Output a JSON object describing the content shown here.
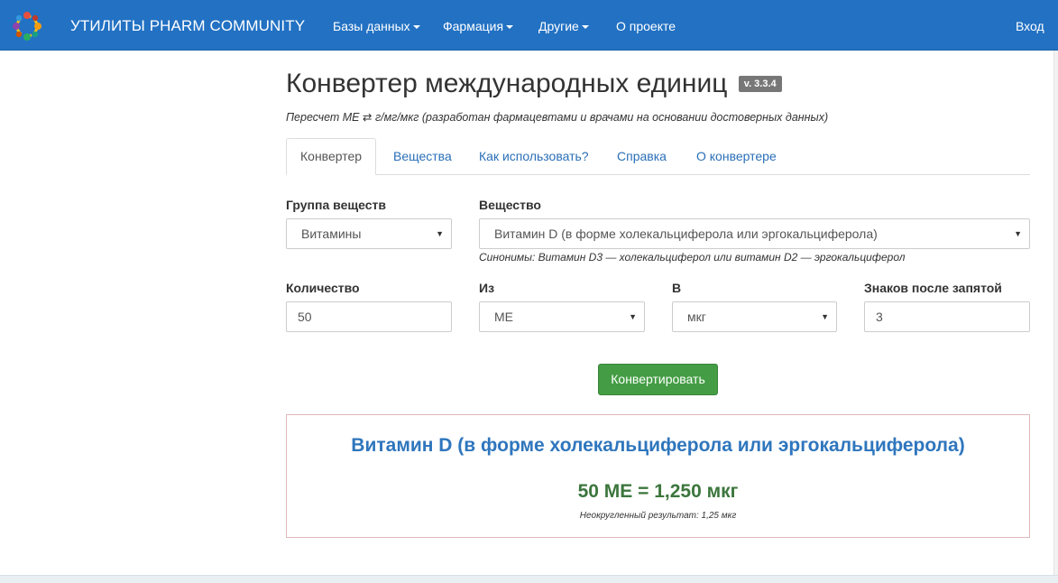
{
  "navbar": {
    "brand": "УТИЛИТЫ PHARM COMMUNITY",
    "items": [
      {
        "label": "Базы данных",
        "dropdown": true
      },
      {
        "label": "Фармация",
        "dropdown": true
      },
      {
        "label": "Другие",
        "dropdown": true
      },
      {
        "label": "О проекте",
        "dropdown": false
      }
    ],
    "login": "Вход",
    "logo_icon": "people-circle-logo-icon",
    "color": "#2271c3"
  },
  "header": {
    "title": "Конвертер международных единиц",
    "version": "v. 3.3.4",
    "subtitle": "Пересчет МЕ ⇄ г/мг/мкг (разработан фармацевтами и врачами на основании достоверных данных)"
  },
  "tabs": [
    {
      "label": "Конвертер",
      "active": true
    },
    {
      "label": "Вещества",
      "active": false
    },
    {
      "label": "Как использовать?",
      "active": false
    },
    {
      "label": "Справка",
      "active": false
    },
    {
      "label": "О конвертере",
      "active": false
    }
  ],
  "form": {
    "group_label": "Группа веществ",
    "group_value": "Витамины",
    "substance_label": "Вещество",
    "substance_value": "Витамин D (в форме холекальциферола или эргокальциферола)",
    "synonyms": "Синонимы: Витамин D3 — холекальциферол или витамин D2 — эргокальциферол",
    "quantity_label": "Количество",
    "quantity_value": "50",
    "from_label": "Из",
    "from_value": "МЕ",
    "to_label": "В",
    "to_value": "мкг",
    "decimals_label": "Знаков после запятой",
    "decimals_value": "3",
    "convert_button": "Конвертировать"
  },
  "result": {
    "title": "Витамин D (в форме холекальциферола или эргокальциферола)",
    "value": "50 МЕ = 1,250 мкг",
    "raw": "Неокругленный результат: 1,25 мкг"
  },
  "colors": {
    "accent": "#2271c3",
    "button": "#449d44",
    "result_title": "#2f76bd",
    "result_value": "#3c763d",
    "link": "#2a6fb8"
  }
}
